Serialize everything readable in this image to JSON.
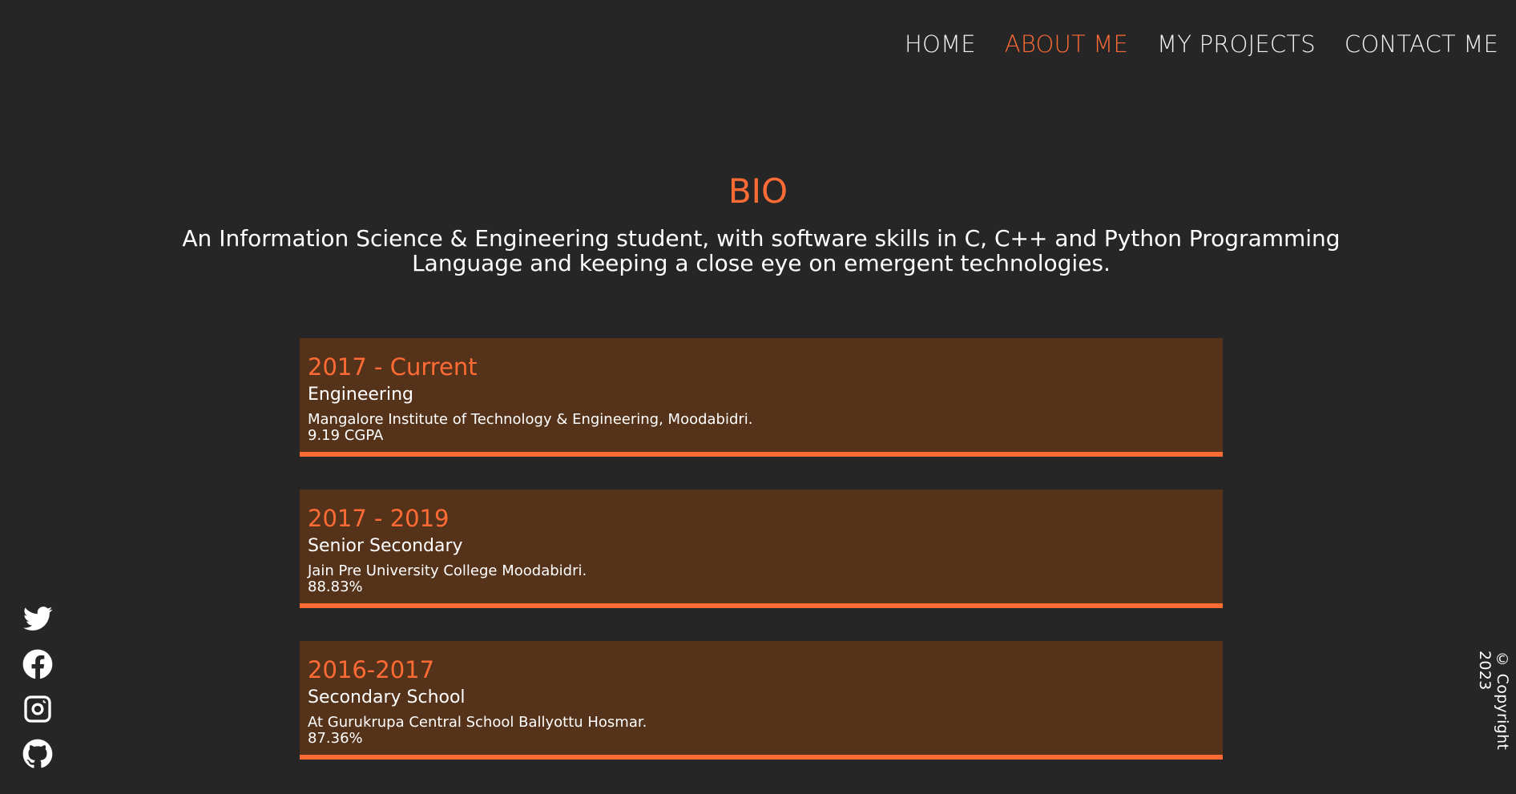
{
  "nav": {
    "items": [
      {
        "label": "HOME",
        "active": false
      },
      {
        "label": "ABOUT ME",
        "active": true
      },
      {
        "label": "MY PROJECTS",
        "active": false
      },
      {
        "label": "CONTACT ME",
        "active": false
      }
    ]
  },
  "bio": {
    "title": "BIO",
    "text": "An Information Science & Engineering student, with software skills in C, C++ and Python Programming Language and keeping a close eye on emergent technologies."
  },
  "education": [
    {
      "years": "2017 - Current",
      "level": "Engineering",
      "school": "Mangalore Institute of Technology & Engineering, Moodabidri.",
      "score": "9.19 CGPA"
    },
    {
      "years": "2017 - 2019",
      "level": "Senior Secondary",
      "school": "Jain Pre University College Moodabidri.",
      "score": "88.83%"
    },
    {
      "years": "2016-2017",
      "level": "Secondary School",
      "school": "At Gurukrupa Central School Ballyottu Hosmar.",
      "score": "87.36%"
    }
  ],
  "social": [
    {
      "icon": "twitter-icon"
    },
    {
      "icon": "facebook-icon"
    },
    {
      "icon": "instagram-icon"
    },
    {
      "icon": "github-icon"
    }
  ],
  "footer": {
    "copyright": "© Copyright 2023"
  },
  "colors": {
    "accent": "#ff6b35",
    "background": "#262626",
    "card": "#55321a"
  }
}
